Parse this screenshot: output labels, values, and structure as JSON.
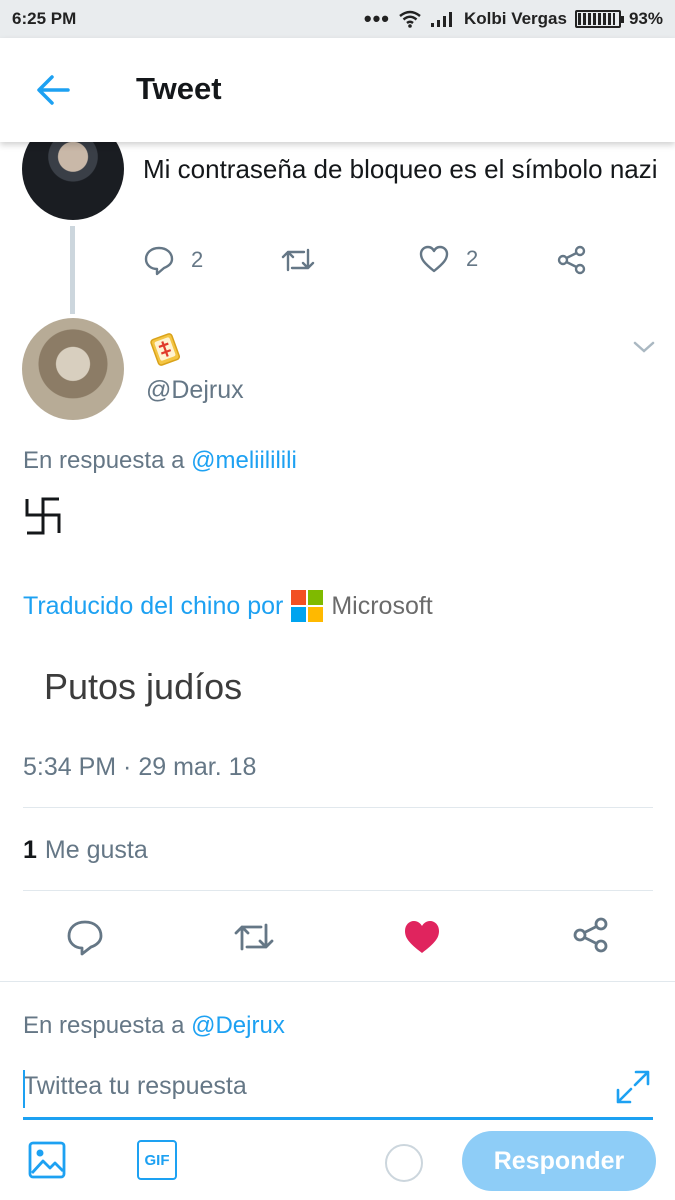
{
  "status_bar": {
    "time": "6:25 PM",
    "carrier": "Kolbi Vergas",
    "battery": "93%",
    "battery_level": 0.93
  },
  "header": {
    "title": "Tweet",
    "back_icon": "arrow-left-icon"
  },
  "parent_tweet": {
    "text": "Mi contraseña de bloqueo es el símbolo nazi",
    "replies": "2",
    "likes": "2",
    "icons": [
      "reply-icon",
      "retweet-icon",
      "heart-icon",
      "share-icon"
    ]
  },
  "main_tweet": {
    "handle": "@Dejrux",
    "badge_icon": "mahjong-tile-emoji",
    "reply_prefix": "En respuesta a",
    "reply_mention": "@meliililili",
    "original_text": "卍",
    "translated_prefix": "Traducido del chino por",
    "translator": "Microsoft",
    "translation": "Putos judíos",
    "timestamp": "5:34 PM · 29 mar. 18",
    "like_count": "1",
    "like_label": "Me gusta",
    "liked": true
  },
  "compose": {
    "reply_prefix": "En respuesta a",
    "reply_mention": "@Dejrux",
    "placeholder": "Twittea tu respuesta",
    "gif_label": "GIF",
    "submit_label": "Responder"
  },
  "colors": {
    "accent": "#1da1f2",
    "like": "#e0245e",
    "muted": "#657786",
    "button_disabled": "#8ecdf7",
    "microsoft": [
      "#f25022",
      "#7fba00",
      "#00a4ef",
      "#ffb900"
    ]
  }
}
